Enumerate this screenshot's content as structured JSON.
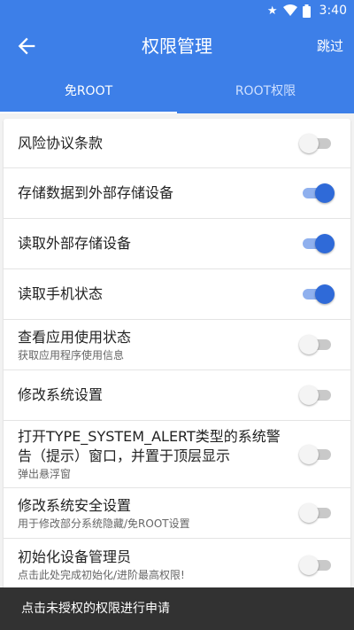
{
  "status_bar": {
    "time": "3:40",
    "icons": [
      "star-icon",
      "wifi-icon",
      "battery-icon"
    ]
  },
  "header": {
    "title": "权限管理",
    "skip_label": "跳过"
  },
  "tabs": [
    {
      "label": "免ROOT",
      "active": true
    },
    {
      "label": "ROOT权限",
      "active": false
    }
  ],
  "permissions": [
    {
      "title": "风险协议条款",
      "subtitle": "",
      "enabled": false
    },
    {
      "title": "存储数据到外部存储设备",
      "subtitle": "",
      "enabled": true
    },
    {
      "title": "读取外部存储设备",
      "subtitle": "",
      "enabled": true
    },
    {
      "title": "读取手机状态",
      "subtitle": "",
      "enabled": true
    },
    {
      "title": "查看应用使用状态",
      "subtitle": "获取应用程序使用信息",
      "enabled": false
    },
    {
      "title": "修改系统设置",
      "subtitle": "",
      "enabled": false
    },
    {
      "title": "打开TYPE_SYSTEM_ALERT类型的系统警告（提示）窗口，并置于顶层显示",
      "subtitle": "弹出悬浮窗",
      "enabled": false
    },
    {
      "title": "修改系统安全设置",
      "subtitle": "用于修改部分系统隐藏/免ROOT设置",
      "enabled": false
    },
    {
      "title": "初始化设备管理员",
      "subtitle": "点击此处完成初始化/进阶最高权限!",
      "enabled": false
    }
  ],
  "snackbar": {
    "message": "点击未授权的权限进行申请"
  },
  "colors": {
    "primary": "#3d7fe8",
    "switch_on": "#2f6ad8",
    "snackbar": "#323232"
  }
}
